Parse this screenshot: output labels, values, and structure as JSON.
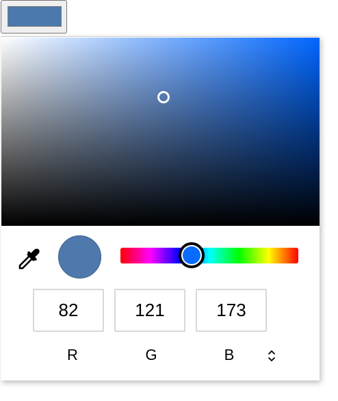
{
  "color_input": {
    "value_hex": "#4c79ad"
  },
  "picker": {
    "hue_color": "#0066ff",
    "selected_color": "#4f79ad",
    "hue_thumb_color": "#0a6cff",
    "hue_degrees": 214,
    "saturation": 0.52,
    "brightness": 0.68,
    "channels": [
      {
        "label": "R",
        "value": "82"
      },
      {
        "label": "G",
        "value": "121"
      },
      {
        "label": "B",
        "value": "173"
      }
    ],
    "icons": {
      "eyedropper": "eyedropper-icon",
      "format_toggle": "up-down-chevron-icon"
    }
  }
}
